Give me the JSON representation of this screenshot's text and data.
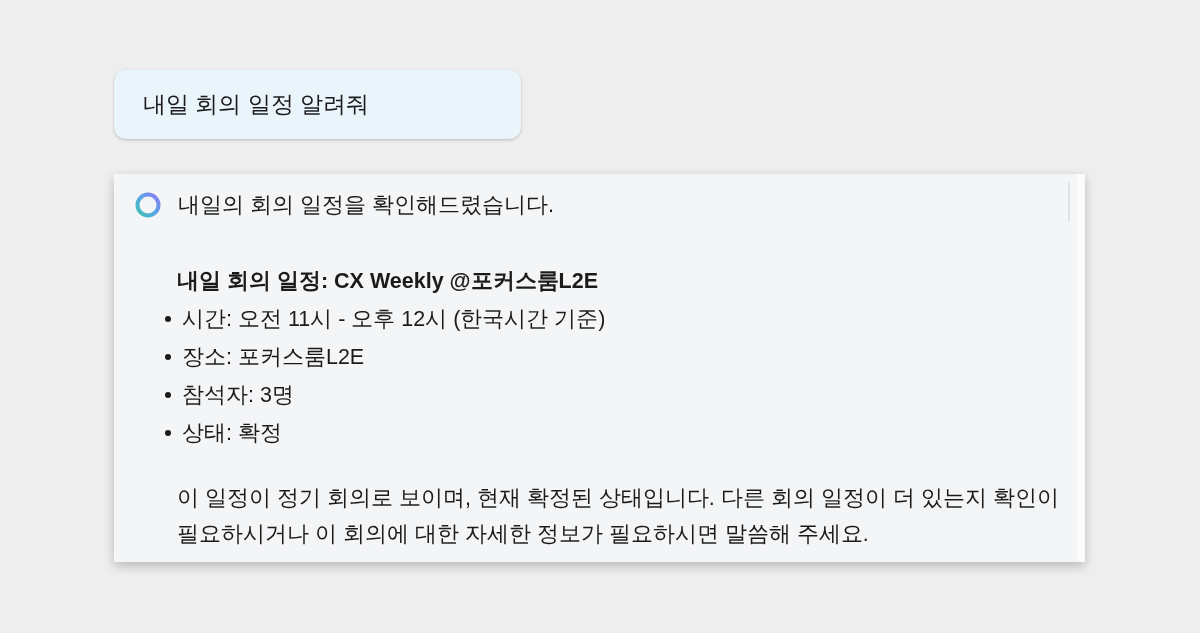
{
  "user_message": {
    "text": "내일 회의 일정 알려줘"
  },
  "assistant_message": {
    "summary": "내일의 회의 일정을 확인해드렸습니다.",
    "heading": "내일 회의 일정: CX Weekly @포커스룸L2E",
    "details": [
      "시간: 오전 11시 - 오후 12시 (한국시간 기준)",
      "장소: 포커스룸L2E",
      "참석자: 3명",
      "상태: 확정"
    ],
    "closing": "이 일정이 정기 회의로 보이며, 현재 확정된 상태입니다. 다른 회의 일정이 더 있는지 확인이 필요하시거나 이 회의에 대한 자세한 정보가 필요하시면 말씀해 주세요."
  }
}
